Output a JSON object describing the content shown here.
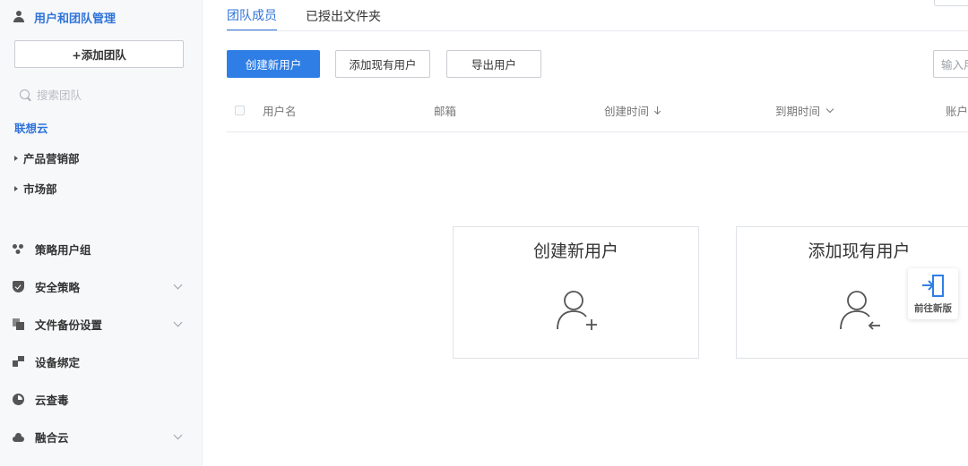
{
  "sidebar": {
    "header": "用户和团队管理",
    "add_team_button": "+添加团队",
    "search_placeholder": "搜索团队",
    "org_name": "联想云",
    "departments": [
      "产品营销部",
      "市场部"
    ],
    "nav_items": [
      {
        "label": "策略用户组",
        "icon": "group-icon",
        "has_chevron": false
      },
      {
        "label": "安全策略",
        "icon": "shield-icon",
        "has_chevron": true
      },
      {
        "label": "文件备份设置",
        "icon": "copy-icon",
        "has_chevron": true
      },
      {
        "label": "设备绑定",
        "icon": "device-icon",
        "has_chevron": false
      },
      {
        "label": "云查毒",
        "icon": "virus-scan-icon",
        "has_chevron": false
      },
      {
        "label": "融合云",
        "icon": "cloud-icon",
        "has_chevron": true
      }
    ]
  },
  "tabs": [
    {
      "label": "团队成员",
      "active": true
    },
    {
      "label": "已授出文件夹",
      "active": false
    }
  ],
  "toolbar": {
    "create_user": "创建新用户",
    "add_existing_user": "添加现有用户",
    "export_users": "导出用户",
    "search_placeholder": "输入用户"
  },
  "table": {
    "columns": [
      "用户名",
      "邮箱",
      "创建时间",
      "到期时间",
      "账户"
    ]
  },
  "cards": [
    {
      "title": "创建新用户",
      "icon": "add-user-icon"
    },
    {
      "title": "添加现有用户",
      "icon": "import-user-icon"
    }
  ],
  "float_button": {
    "label": "前往新版",
    "icon": "door-enter-icon"
  },
  "colors": {
    "accent": "#2f7ee6",
    "accent_text": "#2f73d9"
  }
}
